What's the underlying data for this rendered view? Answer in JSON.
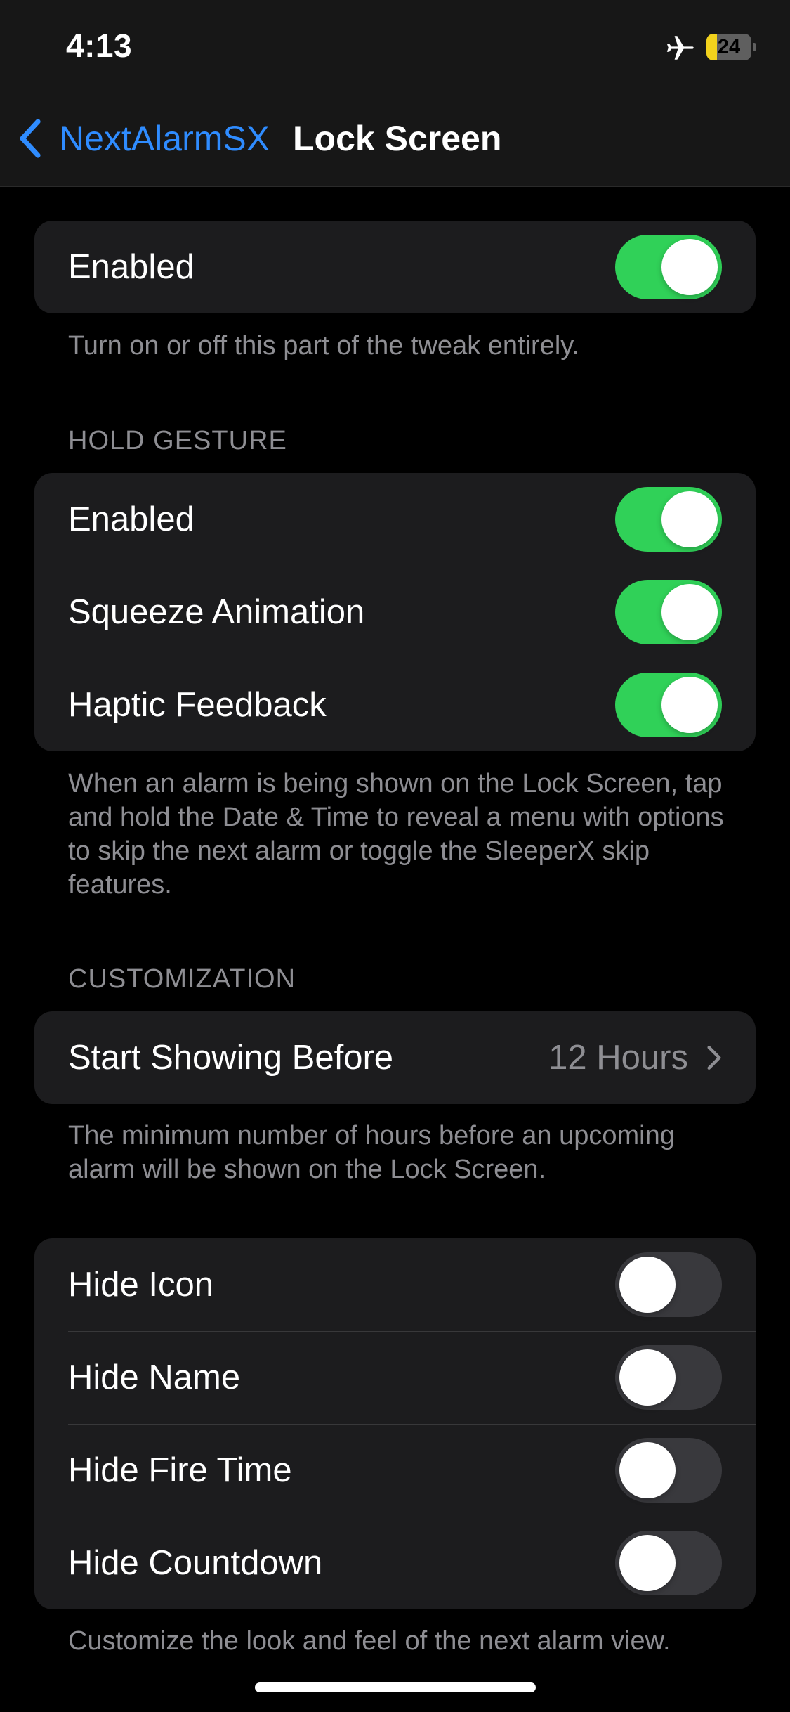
{
  "status_bar": {
    "time": "4:13",
    "battery_level": "24",
    "battery_fraction": 0.24,
    "airplane_mode": true,
    "icons": [
      "airplane-icon",
      "battery-charging-icon"
    ]
  },
  "nav": {
    "back_label": "NextAlarmSX",
    "title": "Lock Screen"
  },
  "main_group": {
    "enabled_label": "Enabled",
    "enabled_on": true,
    "footer": "Turn on or off this part of the tweak entirely."
  },
  "hold_gesture": {
    "header": "HOLD GESTURE",
    "rows": [
      {
        "label": "Enabled",
        "on": true
      },
      {
        "label": "Squeeze Animation",
        "on": true
      },
      {
        "label": "Haptic Feedback",
        "on": true
      }
    ],
    "footer": "When an alarm is being shown on the Lock Screen, tap and hold the Date & Time to reveal a menu with options to skip the next alarm or toggle the SleeperX skip features."
  },
  "customization": {
    "header": "CUSTOMIZATION",
    "start_showing_label": "Start Showing Before",
    "start_showing_value": "12 Hours",
    "footer": "The minimum number of hours before an upcoming alarm will be shown on the Lock Screen."
  },
  "hide_group": {
    "rows": [
      {
        "label": "Hide Icon",
        "on": false
      },
      {
        "label": "Hide Name",
        "on": false
      },
      {
        "label": "Hide Fire Time",
        "on": false
      },
      {
        "label": "Hide Countdown",
        "on": false
      }
    ],
    "footer": "Customize the look and feel of the next alarm view."
  },
  "colors": {
    "accent": "#2f8cff",
    "toggle_on": "#30d158",
    "toggle_off": "#39393d",
    "battery_fill": "#f2d21c",
    "group_bg": "#1c1c1e",
    "secondary_text": "#8e8e93"
  }
}
